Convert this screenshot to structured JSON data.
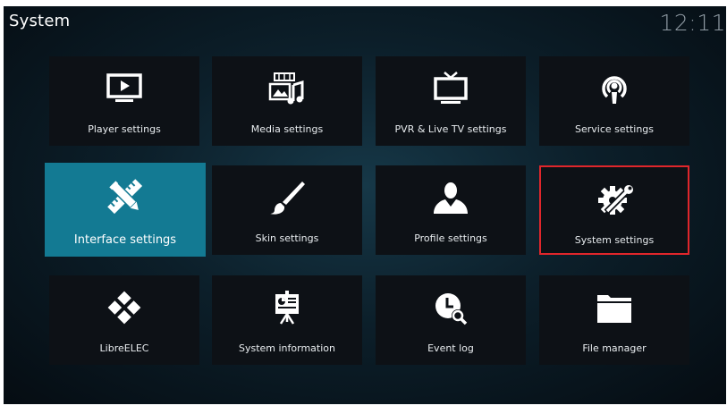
{
  "header": {
    "title": "System",
    "clock": "12:11"
  },
  "tiles": [
    {
      "label": "Player settings",
      "icon": "monitor-play-icon"
    },
    {
      "label": "Media settings",
      "icon": "media-icon"
    },
    {
      "label": "PVR & Live TV settings",
      "icon": "tv-icon"
    },
    {
      "label": "Service settings",
      "icon": "podcast-icon"
    },
    {
      "label": "Interface settings",
      "icon": "pencil-ruler-icon",
      "state": "focused"
    },
    {
      "label": "Skin settings",
      "icon": "paintbrush-icon"
    },
    {
      "label": "Profile settings",
      "icon": "user-icon"
    },
    {
      "label": "System settings",
      "icon": "gear-wrench-icon",
      "state": "highlighted"
    },
    {
      "label": "LibreELEC",
      "icon": "libreelec-icon"
    },
    {
      "label": "System information",
      "icon": "presentation-icon"
    },
    {
      "label": "Event log",
      "icon": "clock-search-icon"
    },
    {
      "label": "File manager",
      "icon": "folder-icon"
    }
  ],
  "colors": {
    "focus_tile": "#137a93",
    "highlight_border": "#e0262b",
    "tile_bg": "#0d1116"
  }
}
